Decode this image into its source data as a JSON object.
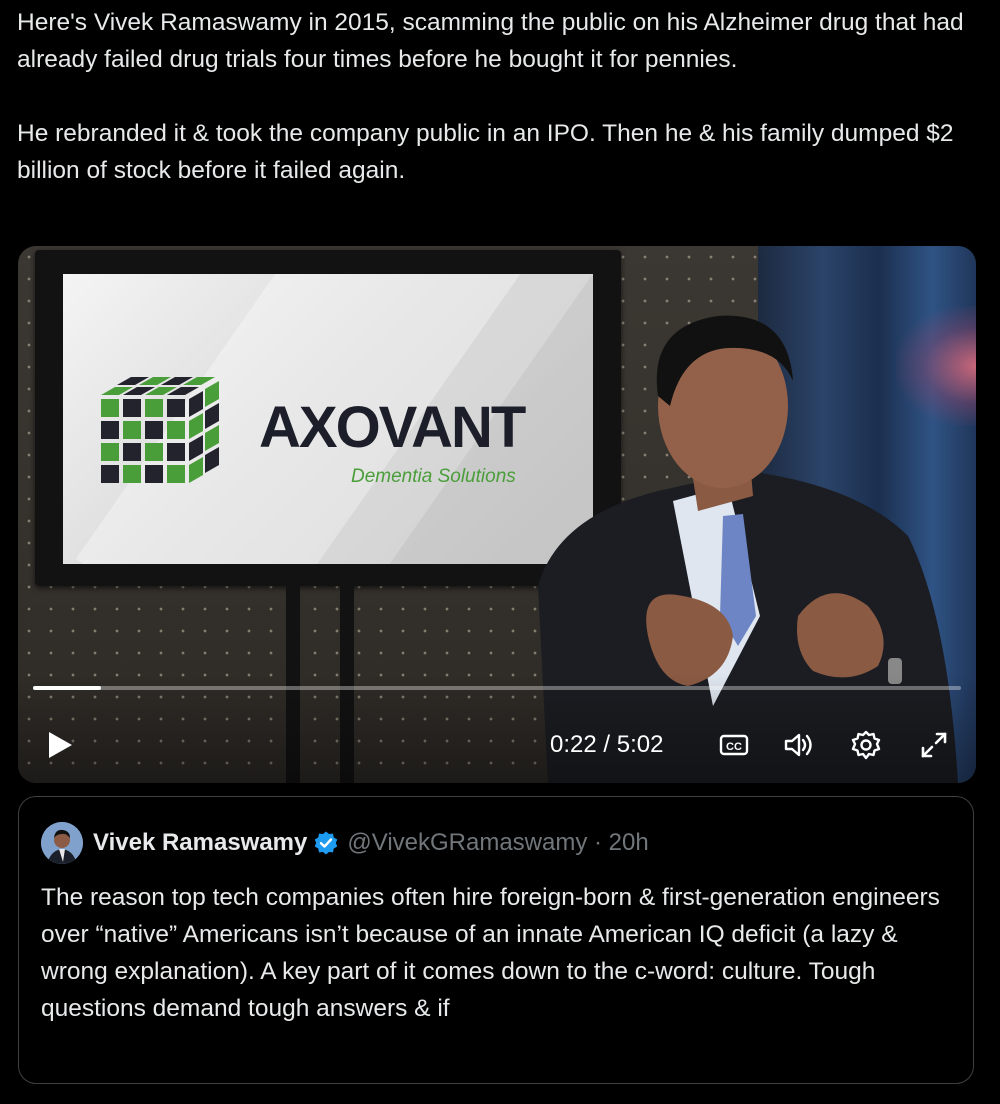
{
  "tweet": {
    "paragraph1": "Here's Vivek Ramaswamy in 2015, scamming the public on his Alzheimer drug that had already failed drug trials four times before he bought it for pennies.",
    "paragraph2": "He rebranded it & took the company public in an IPO. Then he & his family dumped $2 billion of stock before it failed again."
  },
  "video": {
    "screen_brand": "AXOVANT",
    "screen_tagline": "Dementia Solutions",
    "time": "0:22 / 5:02",
    "progress": 0.073,
    "controls": {
      "play_icon": "play-icon",
      "captions_icon": "closed-captions-icon",
      "volume_icon": "volume-icon",
      "settings_icon": "gear-icon",
      "fullscreen_icon": "expand-icon"
    }
  },
  "quote": {
    "name": "Vivek Ramaswamy",
    "handle_time": "@VivekGRamaswamy · 20h",
    "text": "The reason top tech companies often hire foreign-born & first-generation engineers over “native” Americans isn’t because of an innate American IQ deficit (a lazy & wrong explanation). A key part of it comes down to the c-word: culture. Tough questions demand tough answers & if"
  },
  "colors": {
    "background": "#000000",
    "text": "#e7e9ea",
    "muted": "#71767b",
    "verified": "#1d9bf0",
    "border": "#3e4144",
    "logo_green": "#4a9e3a"
  }
}
